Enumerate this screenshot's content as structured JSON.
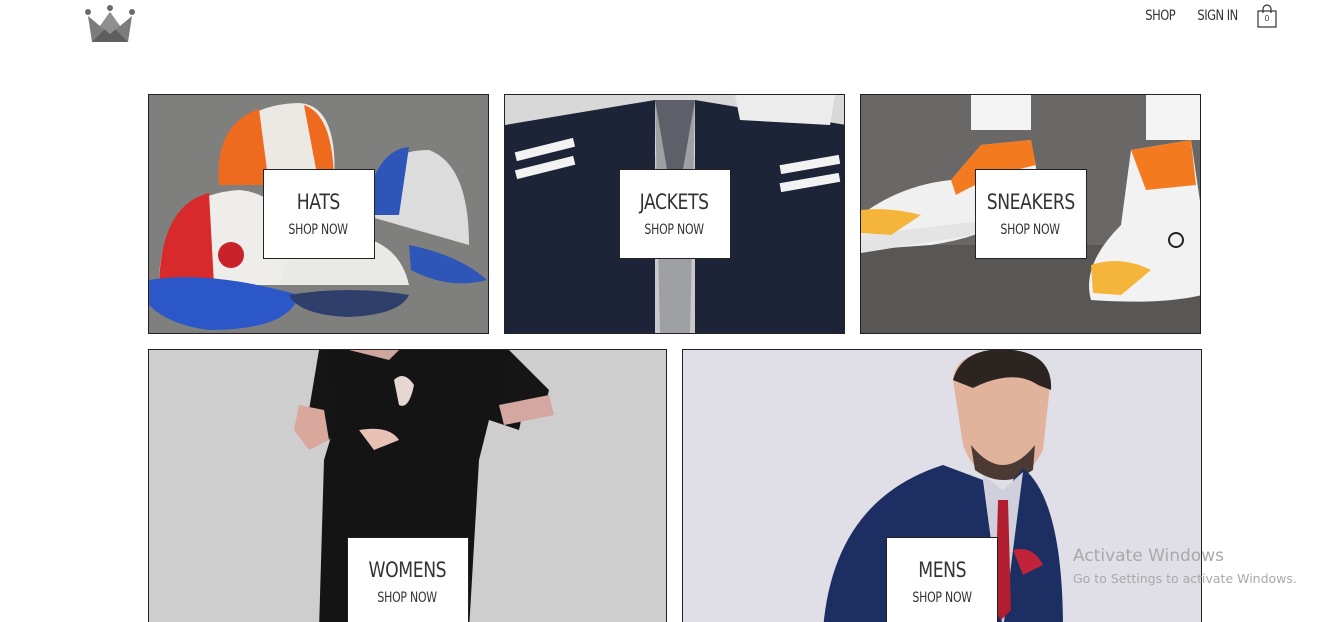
{
  "header": {
    "logo_icon": "crown-icon",
    "nav": {
      "shop": "SHOP",
      "sign_in": "SIGN IN"
    },
    "cart": {
      "icon": "shopping-bag-icon",
      "count": "0"
    }
  },
  "categories": [
    {
      "title": "HATS",
      "cta": "SHOP NOW"
    },
    {
      "title": "JACKETS",
      "cta": "SHOP NOW"
    },
    {
      "title": "SNEAKERS",
      "cta": "SHOP NOW"
    },
    {
      "title": "WOMENS",
      "cta": "SHOP NOW"
    },
    {
      "title": "MENS",
      "cta": "SHOP NOW"
    }
  ],
  "watermark": {
    "title": "Activate Windows",
    "subtitle": "Go to Settings to activate Windows."
  }
}
